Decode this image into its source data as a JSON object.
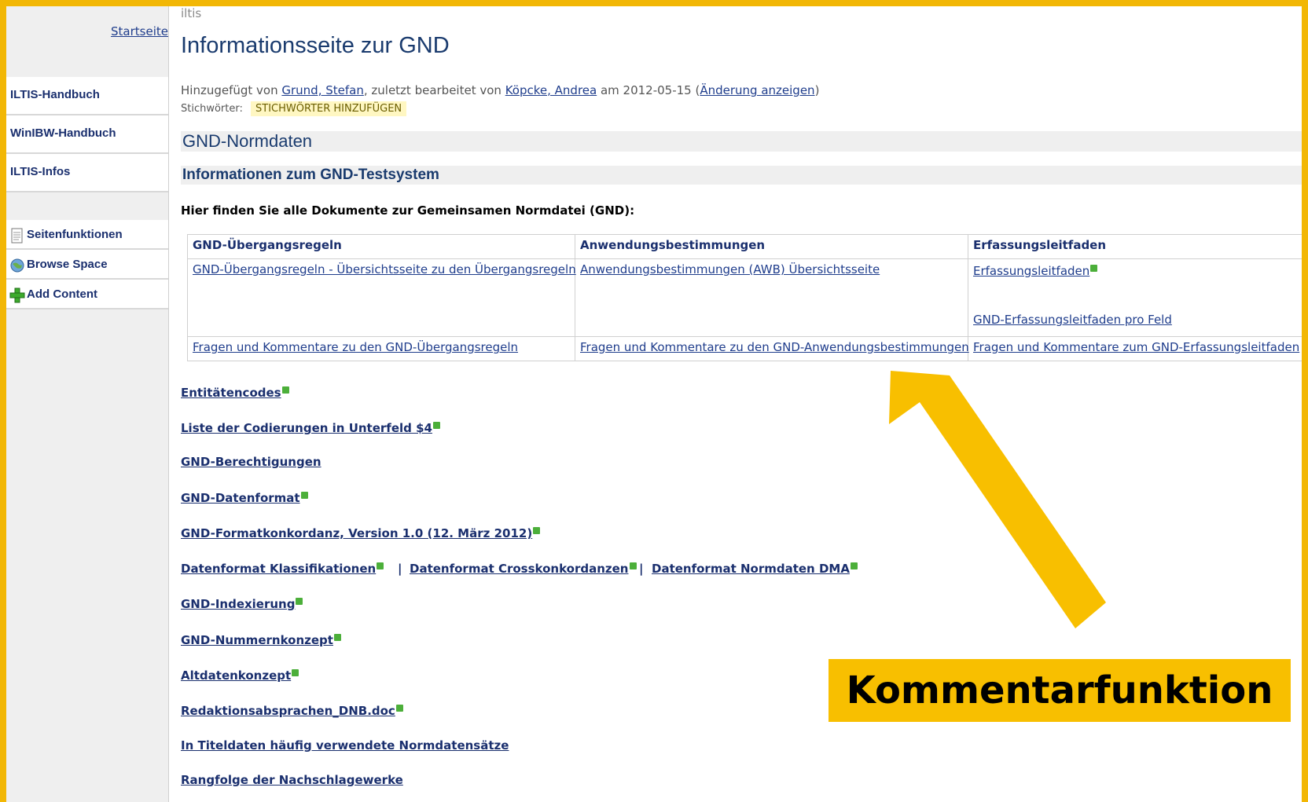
{
  "sidebar": {
    "home_link": "Startseite",
    "nav_items": [
      "ILTIS-Handbuch",
      "WinIBW-Handbuch",
      "ILTIS-Infos"
    ],
    "functions": [
      {
        "label": "Seitenfunktionen",
        "icon": "page-icon"
      },
      {
        "label": "Browse Space",
        "icon": "globe-icon"
      },
      {
        "label": "Add Content",
        "icon": "plus-icon"
      }
    ]
  },
  "page": {
    "space_name": "iltis",
    "title": "Informationsseite zur GND",
    "meta": {
      "added_by_prefix": "Hinzugefügt von ",
      "author": "Grund, Stefan",
      "edited_prefix": ", zuletzt bearbeitet von ",
      "editor": "Köpcke, Andrea",
      "date_text": " am 2012-05-15  (",
      "show_change": "Änderung anzeigen",
      "close_paren": ")"
    },
    "labels_title": "Stichwörter:",
    "add_labels": "STICHWÖRTER HINZUFÜGEN",
    "heading1": "GND-Normdaten",
    "heading2": "Informationen zum GND-Testsystem",
    "intro": "Hier finden Sie alle Dokumente zur Gemeinsamen Normdatei (GND):"
  },
  "table": {
    "headers": [
      "GND-Übergangsregeln",
      "Anwendungsbestimmungen",
      "Erfassungsleitfaden"
    ],
    "row1": {
      "col1": "GND-Übergangsregeln - Übersichtsseite zu den Übergangsregeln",
      "col2": "Anwendungsbestimmungen (AWB) Übersichtsseite",
      "col3a": "Erfassungsleitfaden",
      "col3b": "GND-Erfassungsleitfaden pro Feld"
    },
    "row2": {
      "col1": "Fragen und Kommentare zu den GND-Übergangsregeln",
      "col2": "Fragen und Kommentare zu den GND-Anwendungsbestimmungen",
      "col3": "Fragen und Kommentare zum GND-Erfassungsleitfaden"
    }
  },
  "links": {
    "entitaetencodes": "Entitätencodes",
    "codierungen": "Liste der Codierungen in Unterfeld $4",
    "berechtigungen": "GND-Berechtigungen",
    "datenformat": "GND-Datenformat",
    "formatkonkordanz": "GND-Formatkonkordanz, Version 1.0 (12. März 2012)",
    "df_klassifikationen": "Datenformat Klassifikationen",
    "df_separator": "|",
    "df_crosskonkordanzen": "Datenformat Crosskonkordanzen",
    "df_normdaten_dma": "Datenformat Normdaten DMA",
    "indexierung": "GND-Indexierung",
    "nummernkonzept": "GND-Nummernkonzept",
    "altdatenkonzept": "Altdatenkonzept",
    "redaktionsabsprachen": "Redaktionsabsprachen_DNB.doc",
    "titeldaten": "In Titeldaten häufig verwendete Normdatensätze",
    "rangfolge": "Rangfolge der Nachschlagewerke"
  },
  "annotation": {
    "label": "Kommentarfunktion",
    "color": "#f8bf00"
  }
}
